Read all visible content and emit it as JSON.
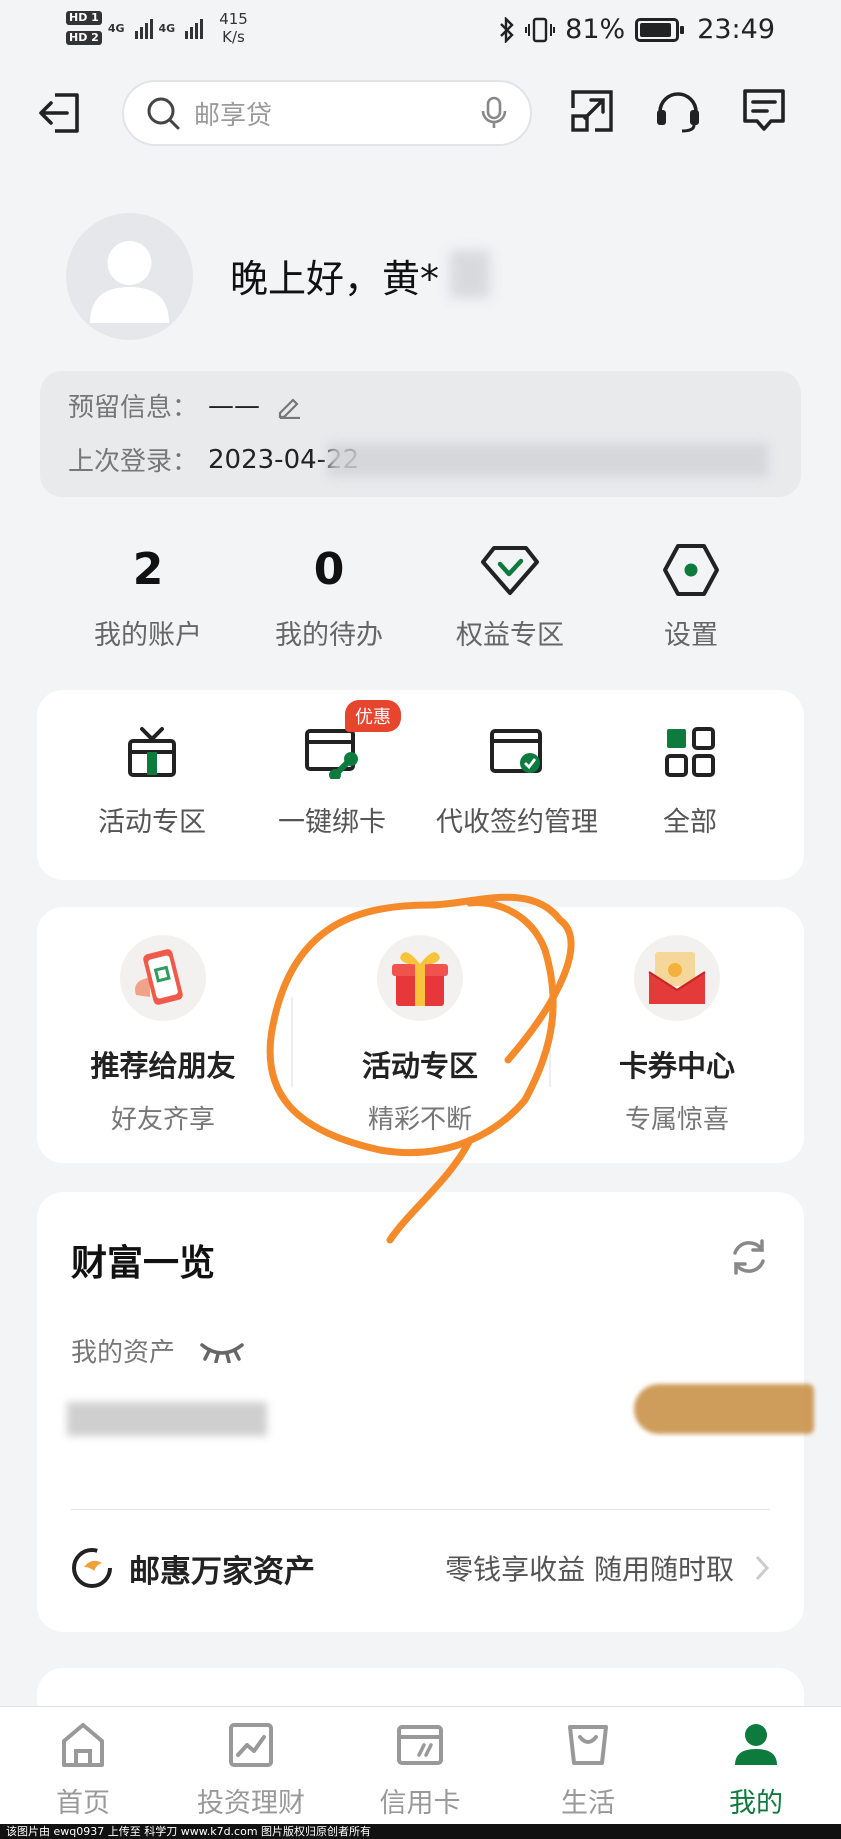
{
  "status_bar": {
    "sim1": "HD 1",
    "sim2": "HD 2",
    "net_type1": "4G",
    "net_type2": "4G",
    "speed_value": "415",
    "speed_unit": "K/s",
    "battery": "81%",
    "time": "23:49"
  },
  "topnav": {
    "search_placeholder": "邮享贷"
  },
  "profile": {
    "greeting": "晚上好，黄*"
  },
  "reserve": {
    "reserve_label": "预留信息：",
    "reserve_value": "——",
    "login_label": "上次登录：",
    "login_value": "2023-04-22"
  },
  "stats": [
    {
      "value": "2",
      "label": "我的账户"
    },
    {
      "value": "0",
      "label": "我的待办"
    },
    {
      "label": "权益专区",
      "icon": "diamond-icon"
    },
    {
      "label": "设置",
      "icon": "settings-icon"
    }
  ],
  "quick": [
    {
      "label": "活动专区",
      "icon": "gift-box-icon"
    },
    {
      "label": "一键绑卡",
      "icon": "bind-card-icon",
      "badge": "优惠"
    },
    {
      "label": "代收签约管理",
      "icon": "contract-icon"
    },
    {
      "label": "全部",
      "icon": "grid-icon"
    }
  ],
  "promo": [
    {
      "title": "推荐给朋友",
      "subtitle": "好友齐享",
      "icon": "phone-qr-icon"
    },
    {
      "title": "活动专区",
      "subtitle": "精彩不断",
      "icon": "present-icon"
    },
    {
      "title": "卡券中心",
      "subtitle": "专属惊喜",
      "icon": "red-envelope-icon"
    }
  ],
  "wealth": {
    "title": "财富一览",
    "asset_label": "我的资产",
    "product_name": "邮惠万家资产",
    "product_desc": "零钱享收益 随用随时取"
  },
  "tabs": [
    {
      "label": "首页",
      "icon": "home-icon"
    },
    {
      "label": "投资理财",
      "icon": "chart-icon"
    },
    {
      "label": "信用卡",
      "icon": "credit-card-icon"
    },
    {
      "label": "生活",
      "icon": "bag-icon"
    },
    {
      "label": "我的",
      "icon": "user-icon",
      "active": true
    }
  ],
  "footer": "该图片由 ewq0937 上传至 科学刀 www.k7d.com 图片版权归原创者所有",
  "colors": {
    "brand_green": "#0d7a3e",
    "annotation_orange": "#f58a2a",
    "badge_red": "#e8452e"
  }
}
